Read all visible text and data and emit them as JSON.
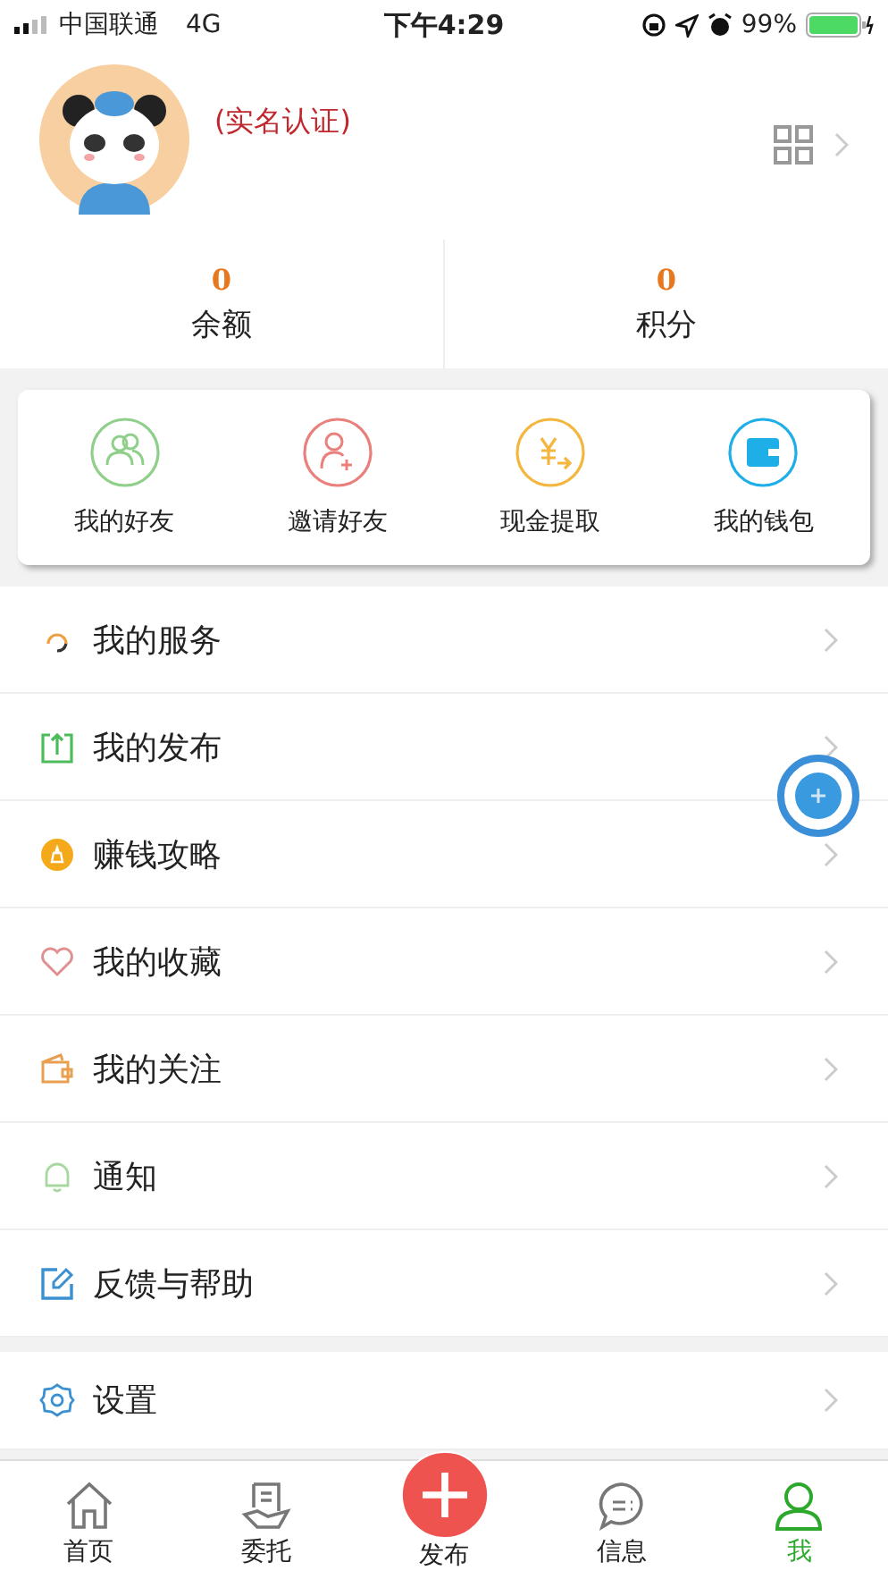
{
  "status_bar": {
    "carrier": "中国联通",
    "network": "4G",
    "time": "下午4:29",
    "battery": "99%"
  },
  "profile": {
    "verify_link": "(实名认证)"
  },
  "stats": [
    {
      "value": "0",
      "label": "余额"
    },
    {
      "value": "0",
      "label": "积分"
    }
  ],
  "quick_actions": [
    {
      "label": "我的好友",
      "kind": "friends",
      "color": "#8fcf8a"
    },
    {
      "label": "邀请好友",
      "kind": "invite",
      "color": "#e9807c"
    },
    {
      "label": "现金提取",
      "kind": "cash",
      "color": "#f3b63f"
    },
    {
      "label": "我的钱包",
      "kind": "wallet",
      "color": "#1eaee8"
    }
  ],
  "menu": [
    {
      "label": "我的服务",
      "kind": "service"
    },
    {
      "label": "我的发布",
      "kind": "publish"
    },
    {
      "label": "赚钱攻略",
      "kind": "earn"
    },
    {
      "label": "我的收藏",
      "kind": "favorite"
    },
    {
      "label": "我的关注",
      "kind": "follow"
    },
    {
      "label": "通知",
      "kind": "notify"
    },
    {
      "label": "反馈与帮助",
      "kind": "feedback"
    }
  ],
  "settings_menu": [
    {
      "label": "设置",
      "kind": "settings"
    }
  ],
  "tab_bar": [
    {
      "label": "首页",
      "kind": "home",
      "selected": false
    },
    {
      "label": "委托",
      "kind": "entrust",
      "selected": false
    },
    {
      "label": "发布",
      "kind": "publish",
      "selected": false
    },
    {
      "label": "信息",
      "kind": "message",
      "selected": false
    },
    {
      "label": "我",
      "kind": "me",
      "selected": true
    }
  ]
}
